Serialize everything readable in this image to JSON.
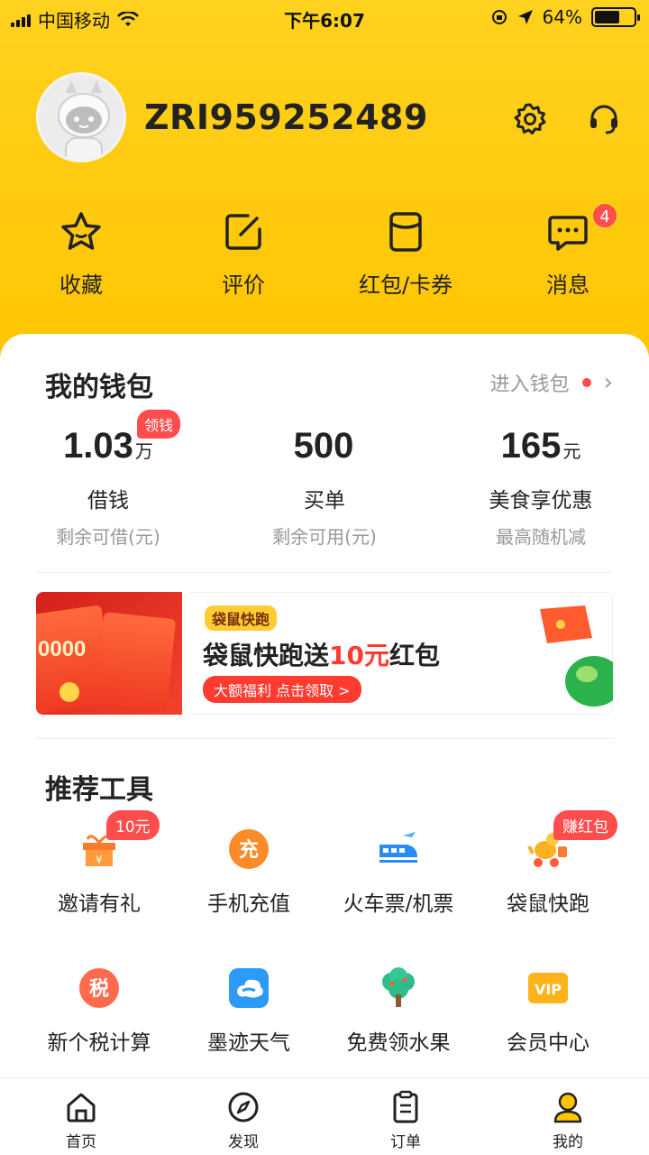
{
  "status_bar": {
    "carrier": "中国移动",
    "time": "下午6:07",
    "battery": "64%",
    "battery_level": 0.64,
    "icons": [
      "signal-icon",
      "wifi-icon",
      "orientation-lock-icon",
      "location-icon",
      "battery-icon"
    ]
  },
  "profile": {
    "username": "ZRI959252489",
    "icons": [
      "avatar",
      "settings-gear-icon",
      "customer-service-icon"
    ]
  },
  "quick_actions": [
    {
      "label": "收藏",
      "icon": "star-icon"
    },
    {
      "label": "评价",
      "icon": "edit-icon"
    },
    {
      "label": "红包/卡券",
      "icon": "coupon-icon"
    },
    {
      "label": "消息",
      "icon": "message-icon",
      "badge": "4"
    }
  ],
  "wallet": {
    "title": "我的钱包",
    "link": "进入钱包",
    "stats": [
      {
        "value": "1.03",
        "unit": "万",
        "name": "借钱",
        "sub": "剩余可借(元)",
        "tag": "领钱"
      },
      {
        "value": "500",
        "unit": "",
        "name": "买单",
        "sub": "剩余可用(元)"
      },
      {
        "value": "165",
        "unit": "元",
        "name": "美食享优惠",
        "sub": "最高随机减"
      }
    ]
  },
  "banner": {
    "left_amount": "0000",
    "logo": "袋鼠快跑",
    "headline_pre": "袋鼠快跑送",
    "headline_hl": "10元",
    "headline_post": "红包",
    "button": "大额福利 点击领取 >"
  },
  "tools": {
    "title": "推荐工具",
    "items": [
      {
        "label": "邀请有礼",
        "icon": "gift-icon",
        "tag": "10元"
      },
      {
        "label": "手机充值",
        "icon": "recharge-icon",
        "glyph": "充"
      },
      {
        "label": "火车票/机票",
        "icon": "train-plane-icon"
      },
      {
        "label": "袋鼠快跑",
        "icon": "kangaroo-icon",
        "tag": "赚红包"
      },
      {
        "label": "新个税计算",
        "icon": "tax-icon",
        "glyph": "税"
      },
      {
        "label": "墨迹天气",
        "icon": "weather-icon"
      },
      {
        "label": "免费领水果",
        "icon": "fruit-tree-icon"
      },
      {
        "label": "会员中心",
        "icon": "vip-icon",
        "glyph": "VIP"
      }
    ]
  },
  "tabbar": [
    {
      "label": "首页",
      "icon": "home-icon"
    },
    {
      "label": "发现",
      "icon": "compass-icon"
    },
    {
      "label": "订单",
      "icon": "order-icon"
    },
    {
      "label": "我的",
      "icon": "profile-icon",
      "active": true
    }
  ],
  "colors": {
    "brand_yellow": "#FFC400",
    "badge_red": "#FF4D4D",
    "highlight_red": "#FF3B30"
  }
}
